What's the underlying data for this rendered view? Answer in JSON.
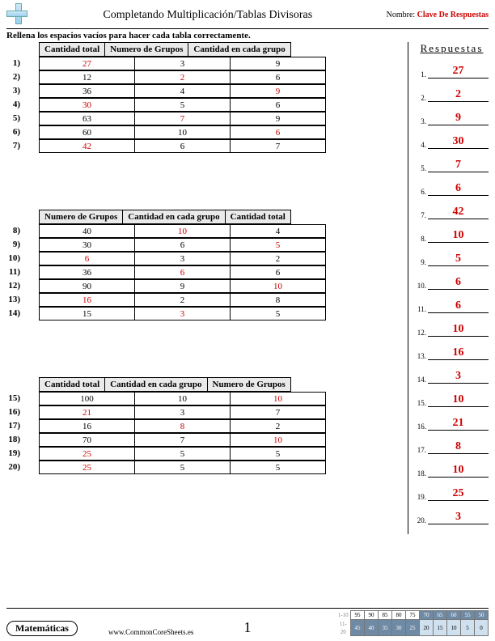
{
  "header": {
    "title": "Completando Multiplicación/Tablas Divisoras",
    "name_label": "Nombre:",
    "name_value": "Clave De Respuestas"
  },
  "instruction": "Rellena los espacios vacíos para hacer cada tabla correctamente.",
  "tables": [
    {
      "headers": [
        "Cantidad total",
        "Numero de Grupos",
        "Cantidad en cada grupo"
      ],
      "start": 1,
      "rows": [
        {
          "c": [
            "27",
            "3",
            "9"
          ],
          "red": [
            0
          ]
        },
        {
          "c": [
            "12",
            "2",
            "6"
          ],
          "red": [
            1
          ]
        },
        {
          "c": [
            "36",
            "4",
            "9"
          ],
          "red": [
            2
          ]
        },
        {
          "c": [
            "30",
            "5",
            "6"
          ],
          "red": [
            0
          ]
        },
        {
          "c": [
            "63",
            "7",
            "9"
          ],
          "red": [
            1
          ]
        },
        {
          "c": [
            "60",
            "10",
            "6"
          ],
          "red": [
            2
          ]
        },
        {
          "c": [
            "42",
            "6",
            "7"
          ],
          "red": [
            0
          ]
        }
      ]
    },
    {
      "headers": [
        "Numero de Grupos",
        "Cantidad en cada grupo",
        "Cantidad total"
      ],
      "start": 8,
      "rows": [
        {
          "c": [
            "40",
            "10",
            "4"
          ],
          "red": [
            1
          ]
        },
        {
          "c": [
            "30",
            "6",
            "5"
          ],
          "red": [
            2
          ]
        },
        {
          "c": [
            "6",
            "3",
            "2"
          ],
          "red": [
            0
          ]
        },
        {
          "c": [
            "36",
            "6",
            "6"
          ],
          "red": [
            1
          ]
        },
        {
          "c": [
            "90",
            "9",
            "10"
          ],
          "red": [
            2
          ]
        },
        {
          "c": [
            "16",
            "2",
            "8"
          ],
          "red": [
            0
          ]
        },
        {
          "c": [
            "15",
            "3",
            "5"
          ],
          "red": [
            1
          ]
        }
      ]
    },
    {
      "headers": [
        "Cantidad total",
        "Cantidad en cada grupo",
        "Numero de Grupos"
      ],
      "start": 15,
      "rows": [
        {
          "c": [
            "100",
            "10",
            "10"
          ],
          "red": [
            2
          ]
        },
        {
          "c": [
            "21",
            "3",
            "7"
          ],
          "red": [
            0
          ]
        },
        {
          "c": [
            "16",
            "8",
            "2"
          ],
          "red": [
            1
          ]
        },
        {
          "c": [
            "70",
            "7",
            "10"
          ],
          "red": [
            2
          ]
        },
        {
          "c": [
            "25",
            "5",
            "5"
          ],
          "red": [
            0
          ]
        },
        {
          "c": [
            "25",
            "5",
            "5"
          ],
          "red": [
            0
          ]
        }
      ]
    }
  ],
  "answers_title": "Respuestas",
  "answers": [
    "27",
    "2",
    "9",
    "30",
    "7",
    "6",
    "42",
    "10",
    "5",
    "6",
    "6",
    "10",
    "16",
    "3",
    "10",
    "21",
    "8",
    "10",
    "25",
    "3"
  ],
  "footer": {
    "subject": "Matemáticas",
    "url": "www.CommonCoreSheets.es",
    "page": "1",
    "score_labels": [
      "1-10",
      "11-20"
    ],
    "score_top": [
      "95",
      "90",
      "85",
      "80",
      "75",
      "70",
      "65",
      "60",
      "55",
      "50"
    ],
    "score_bot": [
      "45",
      "40",
      "35",
      "30",
      "25",
      "20",
      "15",
      "10",
      "5",
      "0"
    ]
  }
}
